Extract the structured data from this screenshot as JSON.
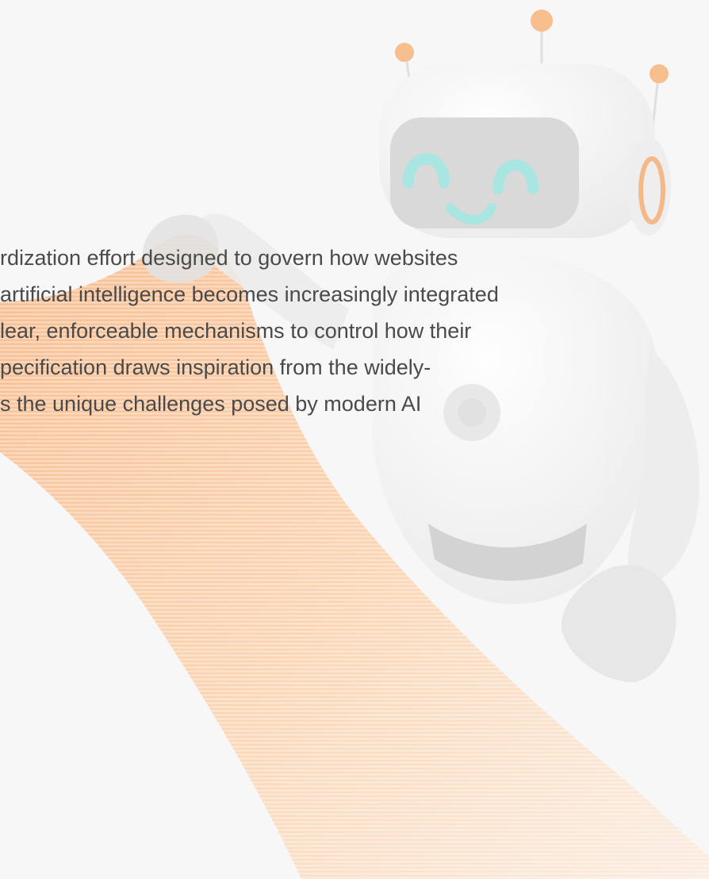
{
  "intro": {
    "lines": [
      "rdization effort designed to govern how websites",
      "artificial intelligence becomes increasingly integrated",
      "lear, enforceable mechanisms to control how their",
      "pecification draws inspiration from the widely-",
      "s the unique challenges posed by modern AI"
    ]
  },
  "colors": {
    "background": "#f7f7f7",
    "text": "#4a4a4a",
    "accent_orange": "#f6a15c",
    "robot_face_glow": "#8fe0dc"
  }
}
